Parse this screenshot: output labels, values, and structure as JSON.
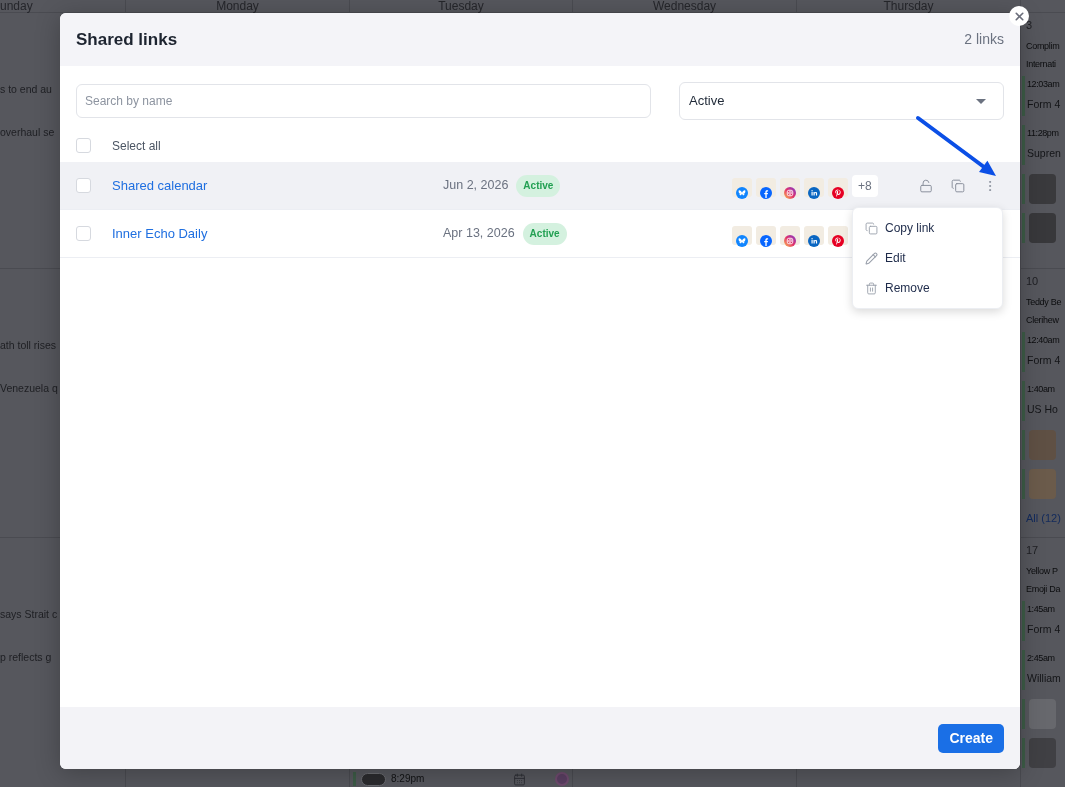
{
  "background_calendar": {
    "day_headers": [
      "unday",
      "Monday",
      "Tuesday",
      "Wednesday",
      "Thursday"
    ],
    "sunday_snippets": [
      [
        "s to end au",
        "overhaul se"
      ],
      [
        "ath toll rises",
        "Venezuela q"
      ],
      [
        "says Strait c",
        "p reflects g"
      ]
    ],
    "tuesday_bottom_event": {
      "time": "8:29pm"
    },
    "friday_weeks": [
      {
        "date": "3",
        "labels": [
          "Complim",
          "Internati"
        ],
        "events": [
          {
            "kind": "text",
            "time": "12:03am",
            "title": "Form 4"
          },
          {
            "kind": "text",
            "time": "11:28pm",
            "title": "Supren"
          },
          {
            "kind": "image"
          },
          {
            "kind": "image"
          }
        ]
      },
      {
        "date": "10",
        "labels": [
          "Teddy Be",
          "Clerihew"
        ],
        "events": [
          {
            "kind": "text",
            "time": "12:40am",
            "title": "Form 4"
          },
          {
            "kind": "text",
            "time": "1:40am",
            "title": "US Ho"
          },
          {
            "kind": "image"
          },
          {
            "kind": "image"
          }
        ],
        "more": "All (12)"
      },
      {
        "date": "17",
        "labels": [
          "Yellow P",
          "Emoji Da"
        ],
        "events": [
          {
            "kind": "text",
            "time": "1:45am",
            "title": "Form 4"
          },
          {
            "kind": "text",
            "time": "2:45am",
            "title": "William"
          },
          {
            "kind": "image"
          },
          {
            "kind": "image"
          }
        ]
      }
    ]
  },
  "dialog": {
    "title": "Shared links",
    "count": "2 links",
    "search": {
      "placeholder": "Search by name"
    },
    "filter": {
      "value": "Active"
    },
    "select_all": {
      "label": "Select all",
      "checked": false
    },
    "rows": [
      {
        "name": "Shared calendar",
        "date": "Jun 2, 2026",
        "status": "Active",
        "checked": false,
        "hovered": true,
        "channels": [
          {
            "kind": "bluesky"
          },
          {
            "kind": "facebook"
          },
          {
            "kind": "instagram"
          },
          {
            "kind": "linkedin"
          },
          {
            "kind": "pinterest"
          }
        ],
        "more": "+8"
      },
      {
        "name": "Inner Echo Daily",
        "date": "Apr 13, 2026",
        "status": "Active",
        "checked": false,
        "hovered": false,
        "channels": [
          {
            "kind": "bluesky"
          },
          {
            "kind": "facebook"
          },
          {
            "kind": "instagram"
          },
          {
            "kind": "linkedin"
          },
          {
            "kind": "pinterest"
          }
        ]
      }
    ],
    "menu": {
      "items": [
        {
          "kind": "copy",
          "label": "Copy link"
        },
        {
          "kind": "edit",
          "label": "Edit"
        },
        {
          "kind": "remove",
          "label": "Remove"
        }
      ]
    },
    "create_button": "Create"
  }
}
